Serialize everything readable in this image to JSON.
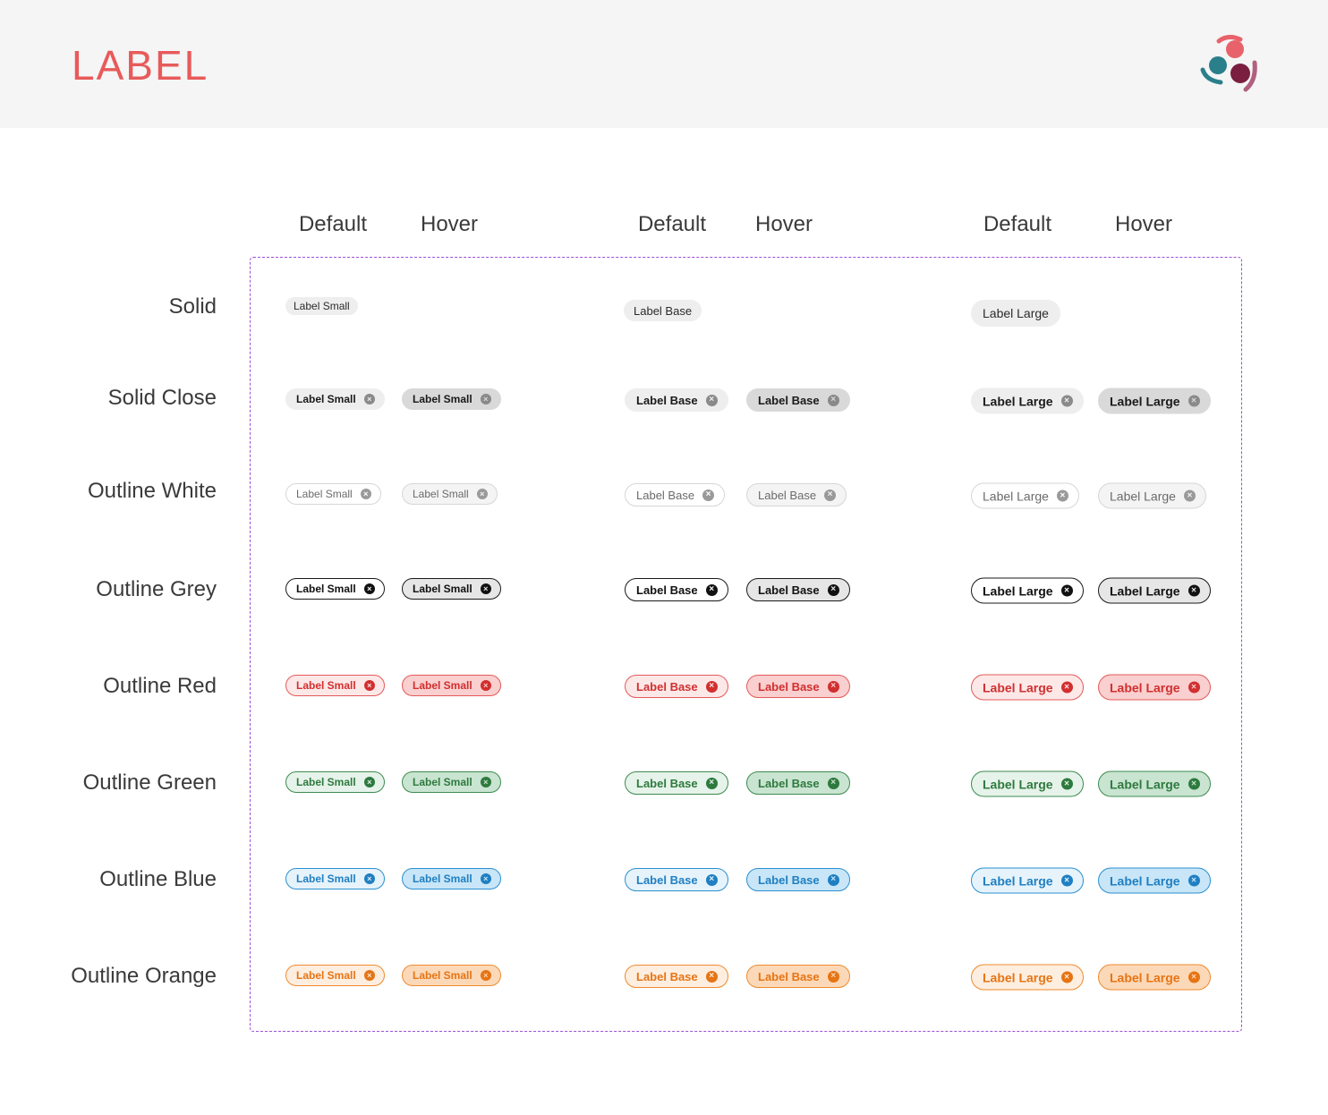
{
  "page": {
    "title": "LABEL"
  },
  "logo": {
    "icon": "three-people-logo-icon",
    "colors": [
      "#e8626b",
      "#2a7f8a",
      "#7a1f3f"
    ]
  },
  "columns": {
    "small_default": "Default",
    "small_hover": "Hover",
    "base_default": "Default",
    "base_hover": "Hover",
    "large_default": "Default",
    "large_hover": "Hover"
  },
  "chip_text": {
    "small": "Label Small",
    "base": "Label Base",
    "large": "Label Large"
  },
  "close_icon": "close-circle-icon",
  "rows": [
    {
      "label": "Solid",
      "default": {
        "bg": "#eeeeee",
        "border": "#eeeeee",
        "text": "#2b2b2b"
      }
    },
    {
      "label": "Solid Close",
      "default": {
        "bg": "#eeeeee",
        "border": "#eeeeee",
        "text": "#1a1a1a",
        "icon_bg": "#8a8a8a"
      },
      "hover": {
        "bg": "#d9d9d9",
        "border": "#d9d9d9",
        "text": "#1a1a1a",
        "icon_bg": "#8a8a8a"
      }
    },
    {
      "label": "Outline White",
      "default": {
        "bg": "#ffffff",
        "border": "#d6d6d6",
        "text": "#6b6b6b",
        "icon_bg": "#9a9a9a"
      },
      "hover": {
        "bg": "#f4f4f4",
        "border": "#d6d6d6",
        "text": "#6b6b6b",
        "icon_bg": "#9a9a9a"
      }
    },
    {
      "label": "Outline Grey",
      "default": {
        "bg": "#ffffff",
        "border": "#1a1a1a",
        "text": "#111111",
        "icon_bg": "#111111"
      },
      "hover": {
        "bg": "#e6e6e6",
        "border": "#1a1a1a",
        "text": "#111111",
        "icon_bg": "#111111"
      }
    },
    {
      "label": "Outline Red",
      "default": {
        "bg": "#fde8e8",
        "border": "#e45a5a",
        "text": "#d12f2f",
        "icon_bg": "#d12f2f"
      },
      "hover": {
        "bg": "#f9cfcf",
        "border": "#e45a5a",
        "text": "#d12f2f",
        "icon_bg": "#d12f2f"
      }
    },
    {
      "label": "Outline Green",
      "default": {
        "bg": "#e6f3ea",
        "border": "#3d8b4f",
        "text": "#2e7a3e",
        "icon_bg": "#2e7a3e"
      },
      "hover": {
        "bg": "#c9e4d1",
        "border": "#3d8b4f",
        "text": "#2e7a3e",
        "icon_bg": "#2e7a3e"
      }
    },
    {
      "label": "Outline Blue",
      "default": {
        "bg": "#e6f3fb",
        "border": "#2b8fd0",
        "text": "#1f7fc2",
        "icon_bg": "#1f7fc2"
      },
      "hover": {
        "bg": "#c8e6f7",
        "border": "#2b8fd0",
        "text": "#1f7fc2",
        "icon_bg": "#1f7fc2"
      }
    },
    {
      "label": "Outline Orange",
      "default": {
        "bg": "#fdeee0",
        "border": "#f08a2e",
        "text": "#e67414",
        "icon_bg": "#e67414"
      },
      "hover": {
        "bg": "#fbd9b8",
        "border": "#f08a2e",
        "text": "#e67414",
        "icon_bg": "#e67414"
      }
    }
  ]
}
